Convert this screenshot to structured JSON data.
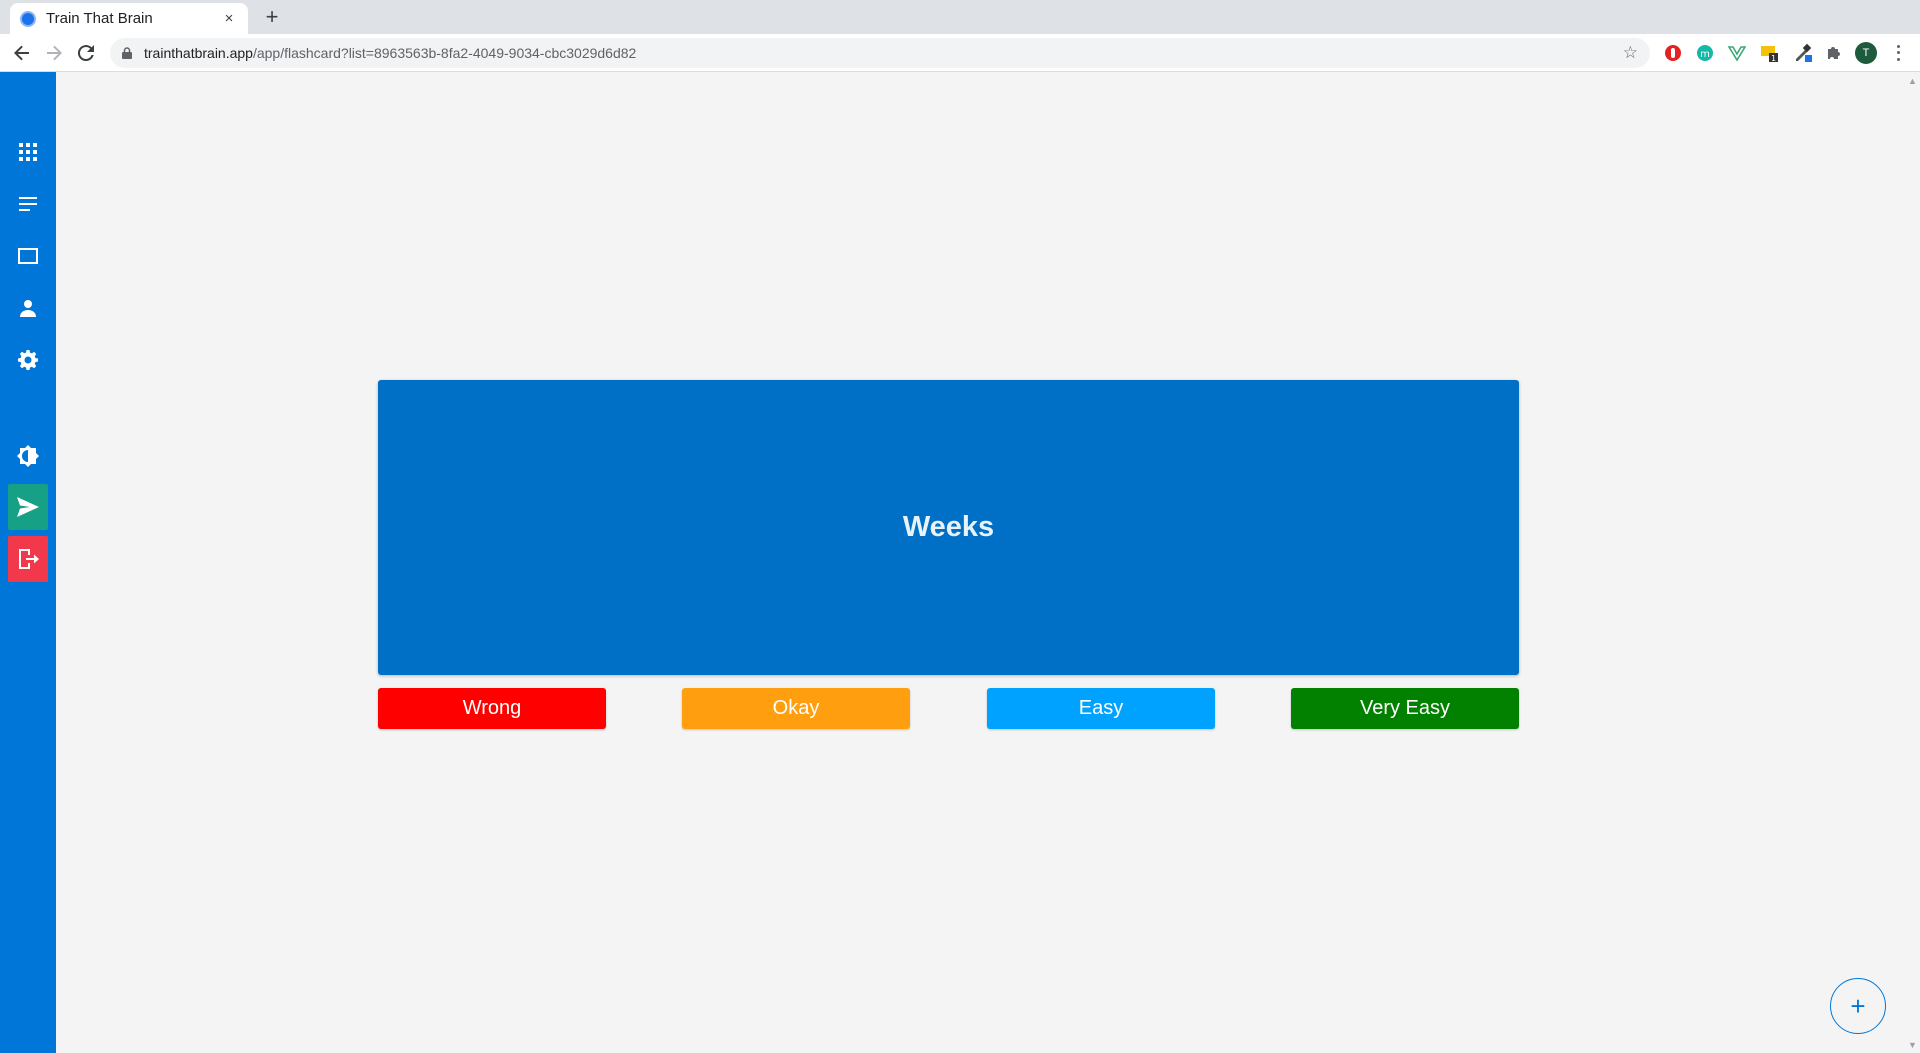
{
  "browser": {
    "tab_title": "Train That Brain",
    "tab_close": "×",
    "new_tab": "+",
    "url_host": "trainthatbrain.app",
    "url_path": "/app/flashcard?list=8963563b-8fa2-4049-9034-cbc3029d6d82",
    "profile_initial": "T"
  },
  "sidebar": {
    "bg_color": "#0077d8",
    "items": [
      {
        "name": "grid-icon"
      },
      {
        "name": "lists-icon"
      },
      {
        "name": "flashcard-icon"
      },
      {
        "name": "user-icon"
      },
      {
        "name": "settings-icon"
      },
      {
        "name": "theme-toggle-icon"
      },
      {
        "name": "send-icon",
        "color": "#16a085"
      },
      {
        "name": "logout-icon",
        "color": "#f2394b"
      }
    ]
  },
  "flashcard": {
    "text": "Weeks",
    "color": "#0070c6"
  },
  "answers": [
    {
      "label": "Wrong",
      "color": "#ff0000"
    },
    {
      "label": "Okay",
      "color": "#ff9f0f"
    },
    {
      "label": "Easy",
      "color": "#00a2ff"
    },
    {
      "label": "Very Easy",
      "color": "#028000"
    }
  ],
  "fab": {
    "label": "+"
  }
}
